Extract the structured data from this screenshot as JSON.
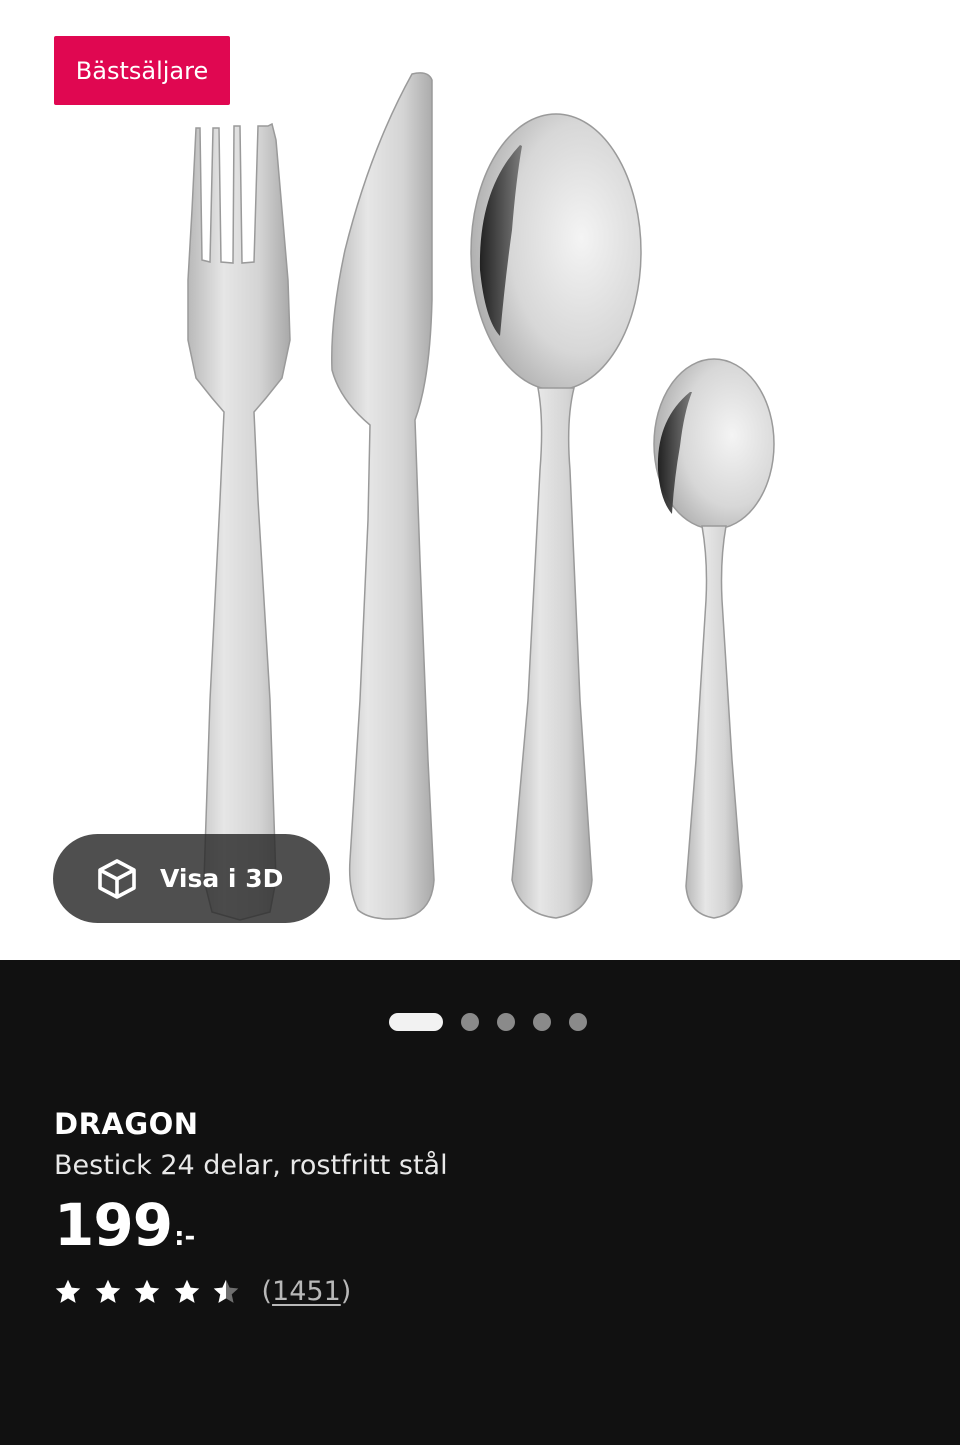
{
  "hero": {
    "badge": "Bästsäljare",
    "view_3d_label": "Visa i 3D",
    "image_icon": "cutlery-product-image"
  },
  "carousel": {
    "slide_count": 5,
    "active_index": 0
  },
  "product": {
    "name": "DRAGON",
    "description": "Bestick 24 delar, rostfritt stål",
    "price_integer": "199",
    "price_suffix": ":-",
    "rating_value": 4.5,
    "rating_max": 5,
    "review_count_text": "1451"
  },
  "colors": {
    "badge_bg": "#e00751",
    "page_bg": "#111111",
    "hero_bg": "#ffffff"
  }
}
